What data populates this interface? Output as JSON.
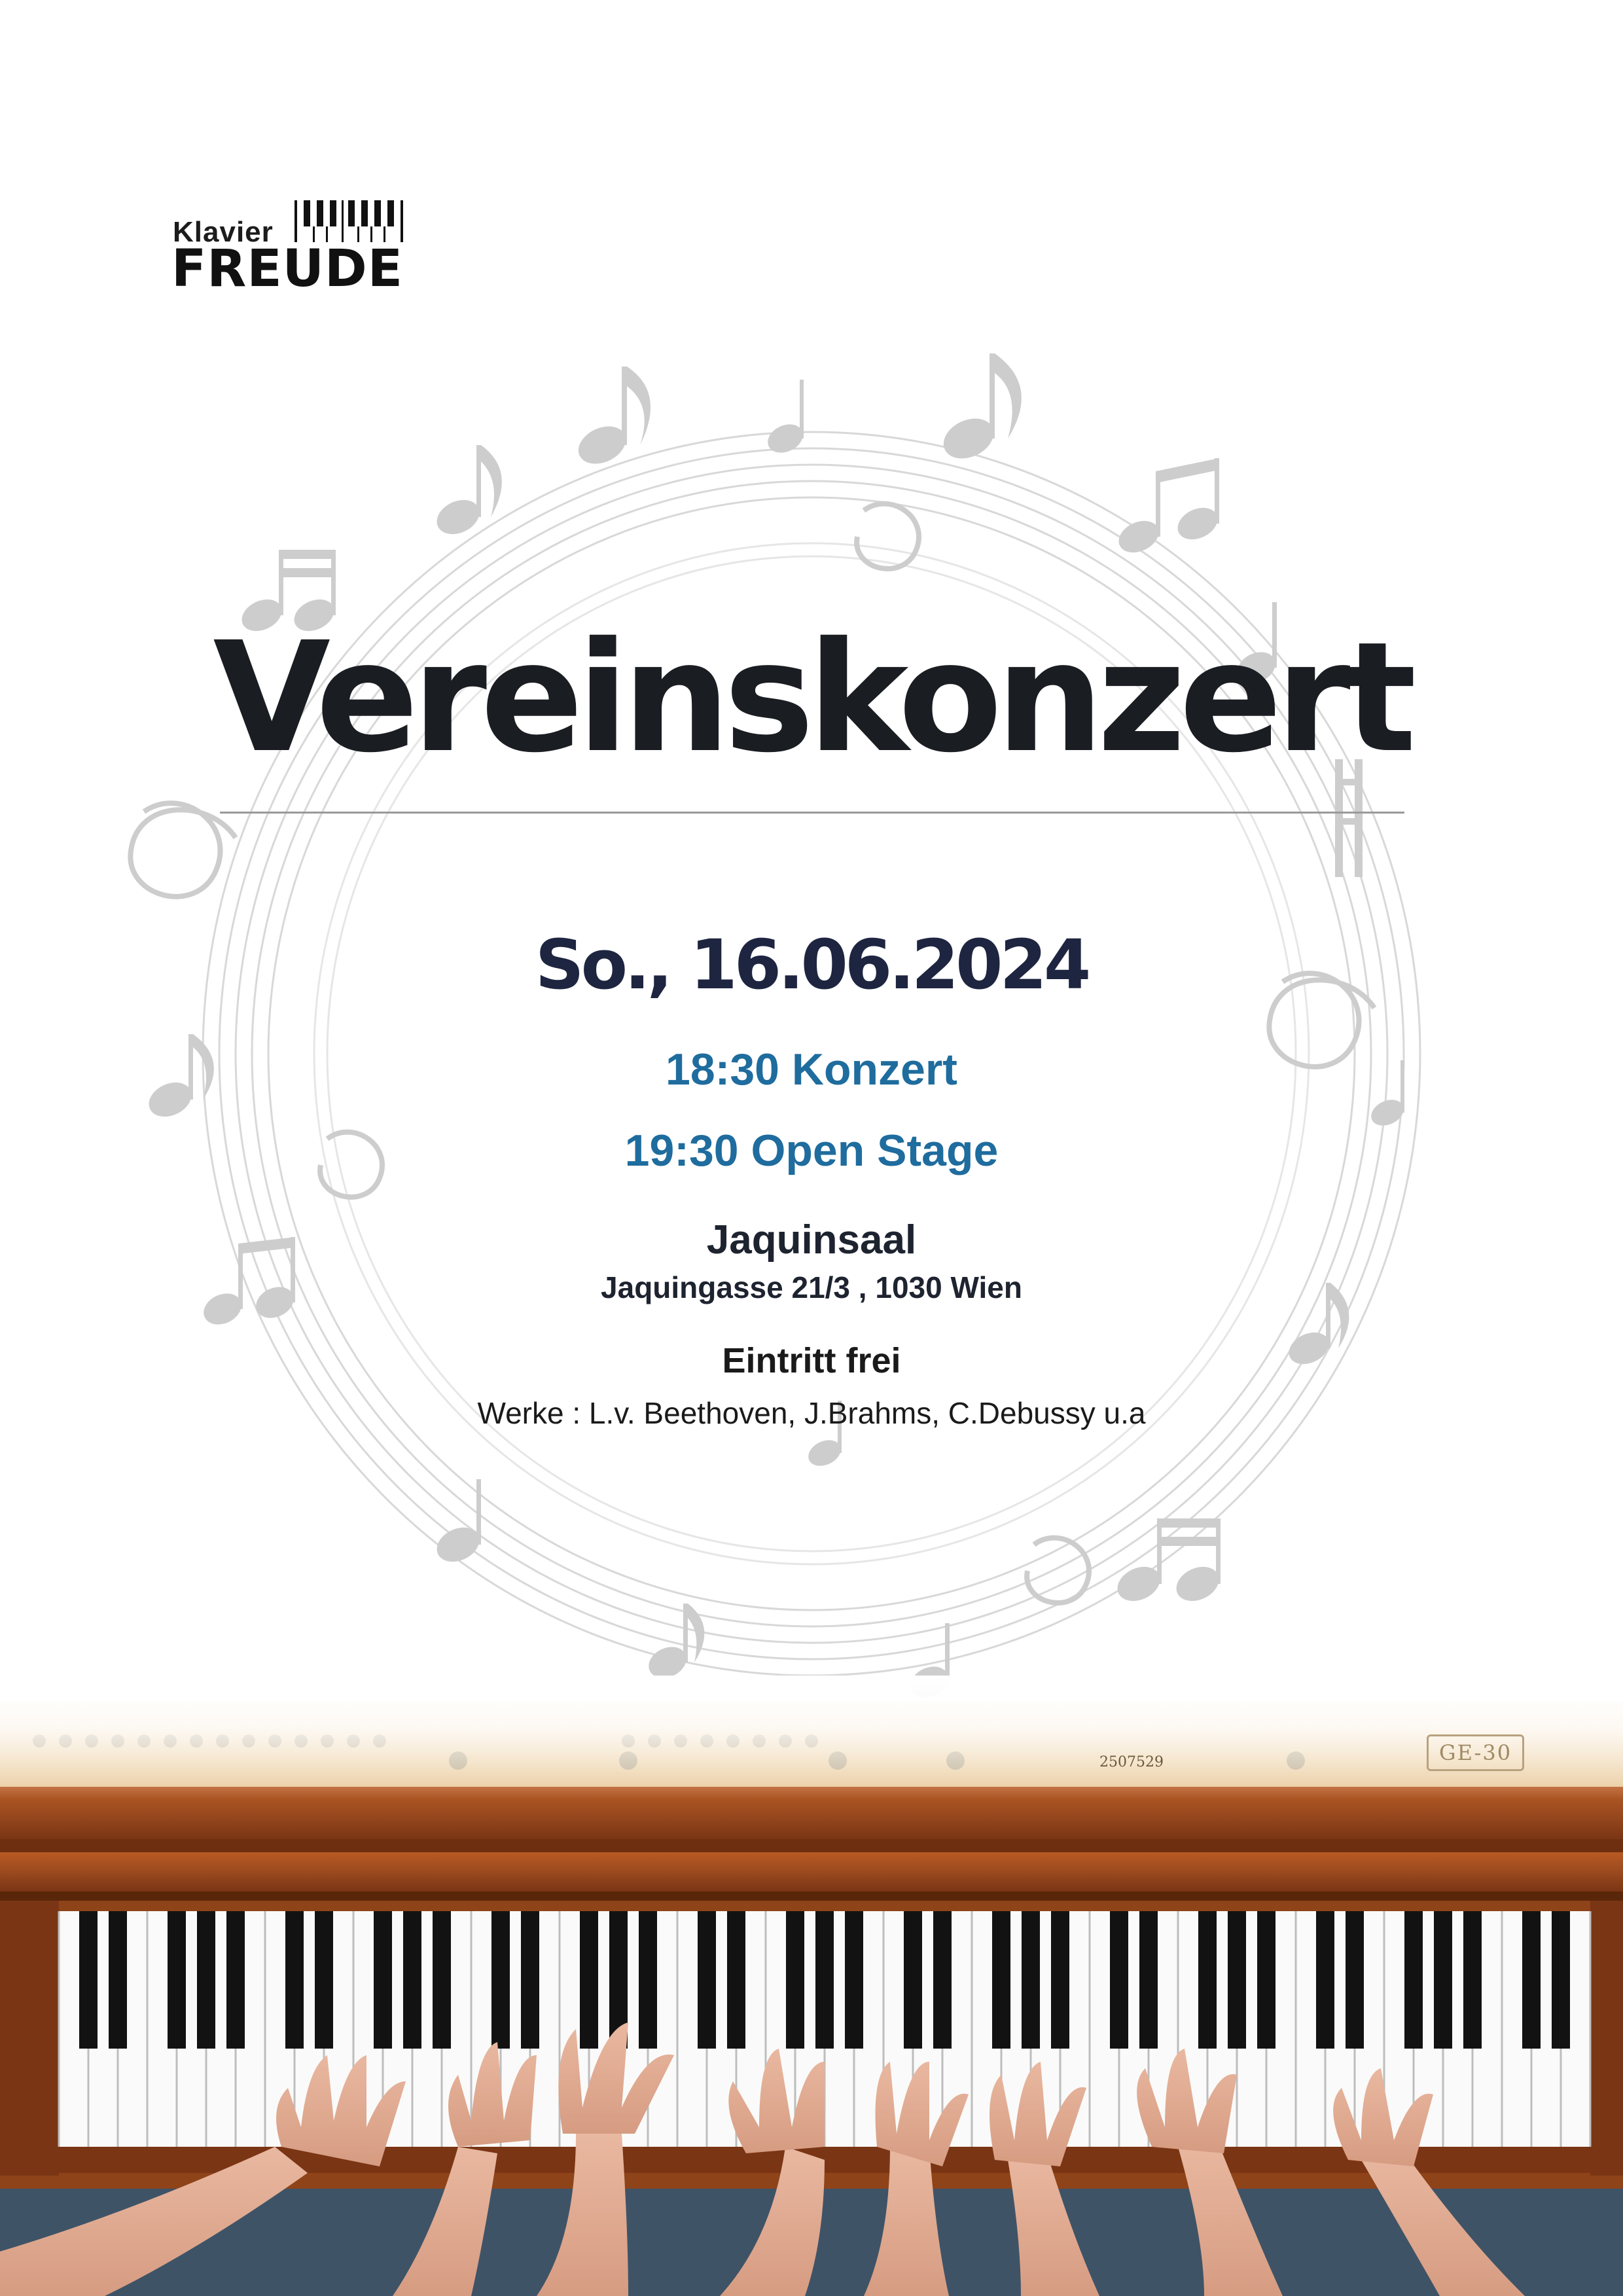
{
  "logo": {
    "top_word": "Klavier",
    "bottom_word": "FREUDE",
    "icon": "piano-keys-icon"
  },
  "title": "Vereinskonzert",
  "date": "So., 16.06.2024",
  "times": [
    "18:30 Konzert",
    "19:30 Open Stage"
  ],
  "venue": {
    "name": "Jaquinsaal",
    "address": "Jaquingasse 21/3 , 1030 Wien"
  },
  "entry": "Eintritt frei",
  "works": "Werke : L.v. Beethoven, J.Brahms, C.Debussy u.a",
  "photo": {
    "serial_number": "2507529",
    "model_plate": "GE-30"
  },
  "colors": {
    "title": "#1a1d21",
    "date": "#1e2540",
    "times": "#1f6c9e",
    "notes": "#cfcfcf",
    "piano_wood": "#9b4a1f"
  },
  "decoration": {
    "background_icon": "music-notes-ring-icon"
  }
}
